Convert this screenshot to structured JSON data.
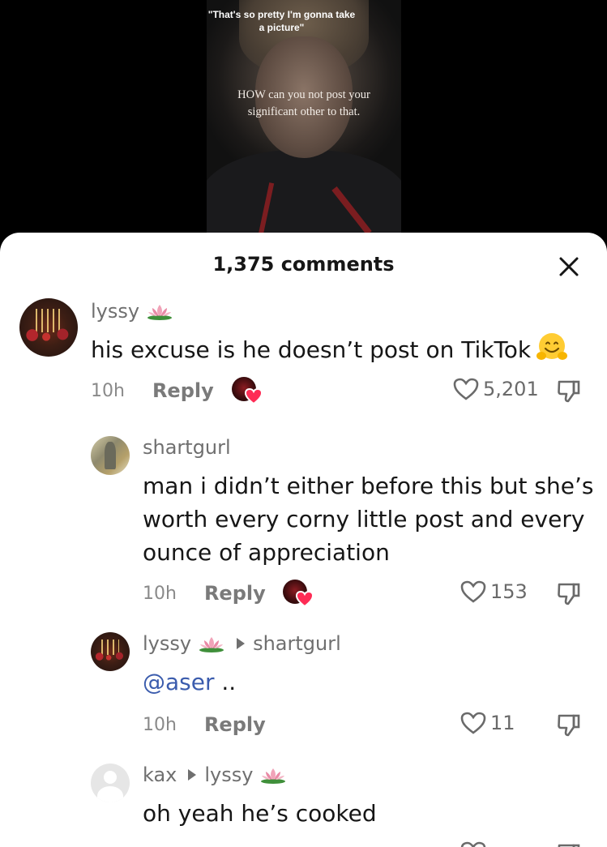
{
  "video": {
    "caption_top": "\"That's so pretty I'm gonna take a picture\"",
    "caption_overlay": "HOW can you not post your significant other to that."
  },
  "sheet": {
    "comments_count": "1,375 comments",
    "close_icon": "close-icon"
  },
  "comments": [
    {
      "username": "lyssy",
      "badge_icon": "lotus-emoji",
      "text": "his excuse is he doesn’t post on TikTok",
      "text_emoji": "hugging-face-emoji",
      "time": "10h",
      "reply_label": "Reply",
      "creator_liked": true,
      "likes": "5,201"
    },
    {
      "username": "shartgurl",
      "text": "man i didn’t either before this but she’s worth every corny little post and every ounce of appreciation",
      "time": "10h",
      "reply_label": "Reply",
      "creator_liked": true,
      "likes": "153"
    },
    {
      "username": "lyssy",
      "badge_icon": "lotus-emoji",
      "reply_to": "shartgurl",
      "mention": "@aser",
      "text_suffix": " ..",
      "time": "10h",
      "reply_label": "Reply",
      "likes": "11"
    },
    {
      "username": "kax",
      "reply_to": "lyssy",
      "reply_to_badge_icon": "lotus-emoji",
      "text": "oh yeah he’s cooked"
    }
  ],
  "colors": {
    "sheet_bg": "#ffffff",
    "text_primary": "#161616",
    "text_secondary": "#6f6f6f",
    "mention": "#3b5cad",
    "creator_heart": "#fe2c55"
  }
}
